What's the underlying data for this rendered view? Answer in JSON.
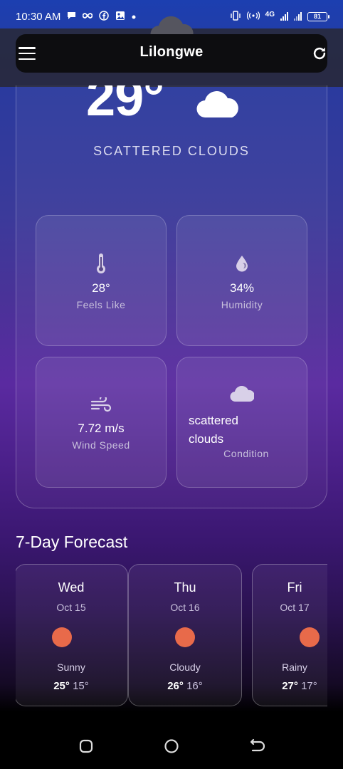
{
  "status_bar": {
    "time": "10:30 AM",
    "network": "4G",
    "battery": "81"
  },
  "header": {
    "city": "Lilongwe",
    "menu_icon": "hamburger-menu-icon",
    "refresh_icon": "refresh-icon"
  },
  "current": {
    "temperature": "29°",
    "description": "SCATTERED CLOUDS",
    "icon": "cloud-icon"
  },
  "stats": [
    {
      "icon": "thermometer-icon",
      "value": "28°",
      "label": "Feels Like"
    },
    {
      "icon": "humidity-drop-icon",
      "value": "34%",
      "label": "Humidity"
    },
    {
      "icon": "wind-icon",
      "value": "7.72 m/s",
      "label": "Wind Speed"
    },
    {
      "icon": "cloud-icon",
      "value": "scattered clouds",
      "label": "Condition"
    }
  ],
  "forecast": {
    "title": "7-Day Forecast",
    "days": [
      {
        "day": "Wed",
        "date": "Oct 15",
        "condition": "Sunny",
        "high": "25°",
        "low": "15°"
      },
      {
        "day": "Thu",
        "date": "Oct 16",
        "condition": "Cloudy",
        "high": "26°",
        "low": "16°"
      },
      {
        "day": "Fri",
        "date": "Oct 17",
        "condition": "Rainy",
        "high": "27°",
        "low": "17°"
      }
    ]
  },
  "colors": {
    "accent_sun": "#e86a4a",
    "header_bar": "#0d0d10"
  }
}
